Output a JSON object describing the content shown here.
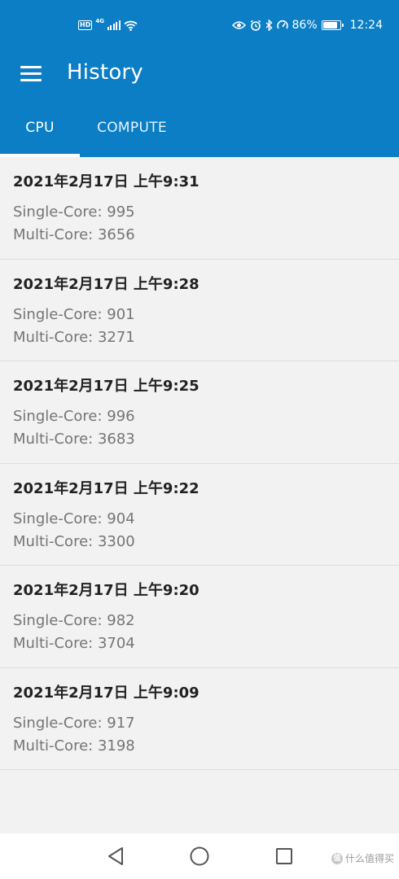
{
  "status_bar": {
    "left": {
      "hd": "HD",
      "network": "4G"
    },
    "right": {
      "battery": "86%",
      "time": "12:24"
    }
  },
  "app_bar": {
    "title": "History"
  },
  "tabs": [
    {
      "label": "CPU",
      "selected": true
    },
    {
      "label": "COMPUTE",
      "selected": false
    }
  ],
  "history": [
    {
      "date": "2021年2月17日 上午9:31",
      "single": "Single-Core: 995",
      "multi": "Multi-Core: 3656"
    },
    {
      "date": "2021年2月17日 上午9:28",
      "single": "Single-Core: 901",
      "multi": "Multi-Core: 3271"
    },
    {
      "date": "2021年2月17日 上午9:25",
      "single": "Single-Core: 996",
      "multi": "Multi-Core: 3683"
    },
    {
      "date": "2021年2月17日 上午9:22",
      "single": "Single-Core: 904",
      "multi": "Multi-Core: 3300"
    },
    {
      "date": "2021年2月17日 上午9:20",
      "single": "Single-Core: 982",
      "multi": "Multi-Core: 3704"
    },
    {
      "date": "2021年2月17日 上午9:09",
      "single": "Single-Core: 917",
      "multi": "Multi-Core: 3198"
    }
  ],
  "watermark": {
    "logo": "值",
    "text": "什么值得买"
  },
  "icons": {
    "menu": "hamburger-menu-icon",
    "back": "back-triangle-icon",
    "home": "home-circle-icon",
    "recent": "recents-square-icon"
  },
  "colors": {
    "primary": "#0b7ec6",
    "background": "#f2f2f2",
    "date_text": "#212121",
    "score_text": "#757575"
  }
}
